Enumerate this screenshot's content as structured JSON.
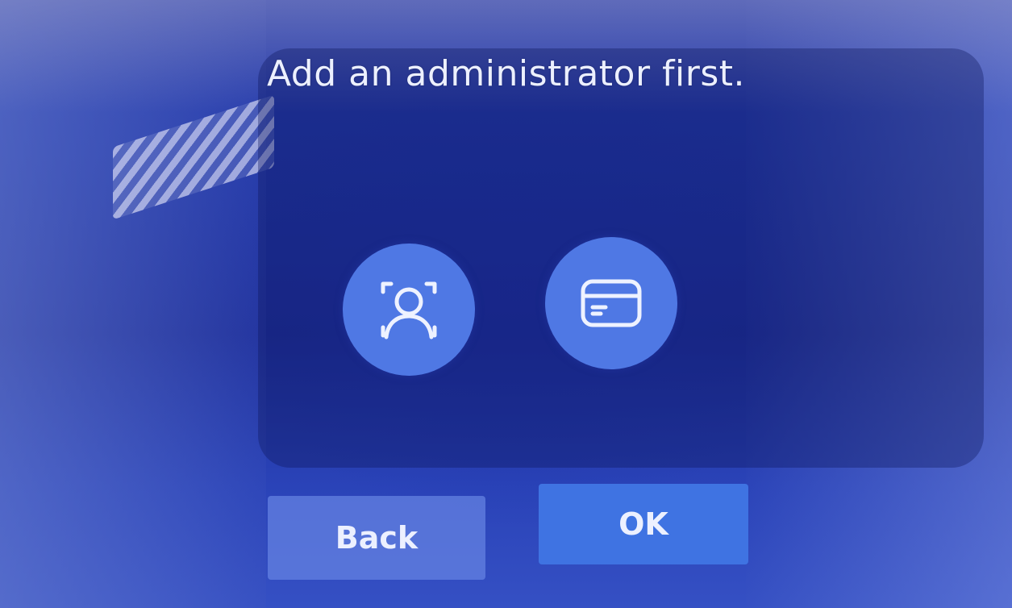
{
  "dialog": {
    "title": "Add an administrator first."
  },
  "options": [
    {
      "icon": "face-scan-icon"
    },
    {
      "icon": "card-icon"
    }
  ],
  "buttons": {
    "back_label": "Back",
    "ok_label": "OK"
  },
  "colors": {
    "background": "#2238a8",
    "icon_circle": "#4f78e4",
    "ok_button": "#3f73e2",
    "back_button": "#6482e1",
    "text": "#ecf0ff"
  }
}
